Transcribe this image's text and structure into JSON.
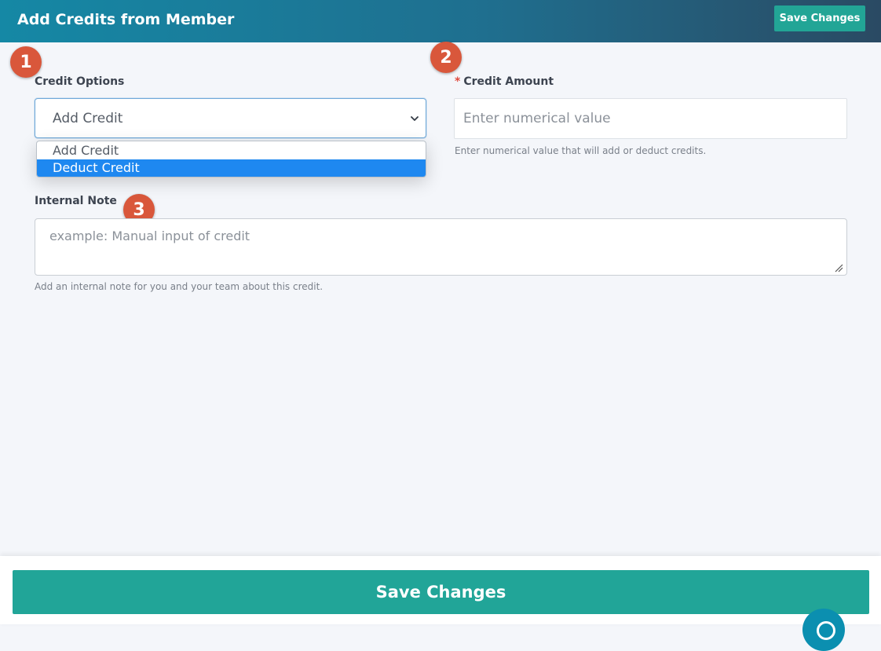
{
  "header": {
    "title": "Add Credits from Member",
    "save_label": "Save Changes"
  },
  "badges": [
    "1",
    "2",
    "3"
  ],
  "credit_options": {
    "label": "Credit Options",
    "selected": "Add Credit",
    "options": [
      "Add Credit",
      "Deduct Credit"
    ],
    "highlighted_option": "Deduct Credit"
  },
  "credit_amount": {
    "required_mark": "*",
    "label": "Credit Amount",
    "placeholder": "Enter numerical value",
    "value": "",
    "help": "Enter numerical value that will add or deduct credits."
  },
  "internal_note": {
    "label": "Internal Note",
    "placeholder": "example: Manual input of credit",
    "value": "",
    "help": "Add an internal note for you and your team about this credit."
  },
  "footer": {
    "save_label": "Save Changes"
  },
  "icons": {
    "chevron": "chevron-down-icon",
    "resize": "resize-handle-icon",
    "chat": "chat-widget-icon"
  },
  "colors": {
    "accent": "#21a598",
    "header_start": "#1588a5",
    "header_end": "#2a4a63",
    "badge": "#d9573b",
    "option_highlight": "#1e88f0",
    "required": "#e04b3f"
  }
}
